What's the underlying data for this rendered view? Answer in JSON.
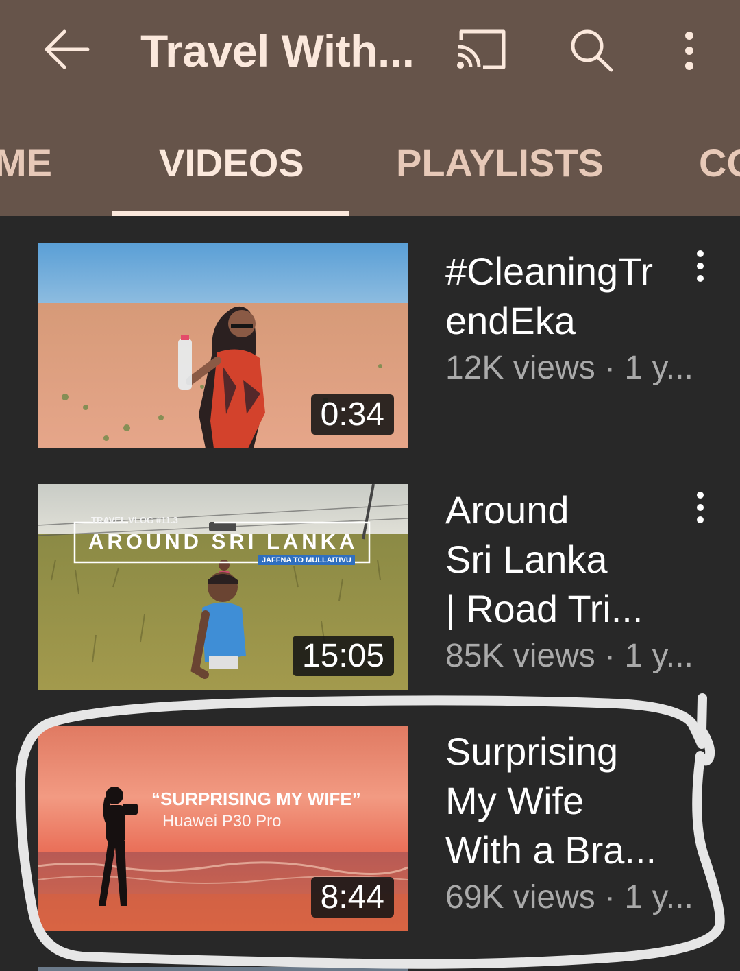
{
  "header": {
    "title": "Travel With...",
    "icons": [
      "back-arrow-icon",
      "cast-icon",
      "search-icon",
      "more-vert-icon"
    ]
  },
  "tabs": [
    {
      "label": "HOME",
      "visible_label": "ME",
      "active": false
    },
    {
      "label": "VIDEOS",
      "active": true
    },
    {
      "label": "PLAYLISTS",
      "active": false
    },
    {
      "label": "COMMUNITY",
      "visible_label": "CO",
      "active": false
    }
  ],
  "videos": [
    {
      "title_line1": "#CleaningTr",
      "title_line2": "endEka",
      "stats": "12K views · 1 y...",
      "duration": "0:34"
    },
    {
      "title_line1": "Around",
      "title_line2": "Sri Lanka",
      "title_line3": "|  Road Tri...",
      "stats": "85K views · 1 y...",
      "duration": "15:05",
      "thumb_text": {
        "kicker": "TRAVEL VLOG #11.3",
        "headline": "AROUND SRI LANKA",
        "sub": "JAFFNA TO MULLAITIVU"
      }
    },
    {
      "title_line1": "Surprising",
      "title_line2": "My Wife",
      "title_line3": "With a Bra...",
      "stats": "69K views · 1 y...",
      "duration": "8:44",
      "thumb_text": {
        "headline": "“SURPRISING MY WIFE”",
        "sub": "Huawei P30 Pro"
      }
    }
  ],
  "colors": {
    "appbar": "#66544a",
    "background": "#282828",
    "title_text": "#fbe8dc",
    "tab_inactive": "#e7c9b8",
    "stats_text": "#aaaaaa",
    "annotation": "#e6e6e6"
  }
}
